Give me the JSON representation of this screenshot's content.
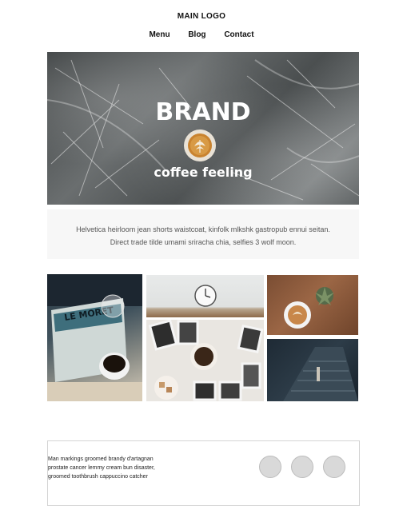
{
  "header": {
    "logo": "MAIN LOGO",
    "nav": [
      "Menu",
      "Blog",
      "Contact"
    ]
  },
  "hero": {
    "title": "BRAND",
    "subtitle": "coffee feeling"
  },
  "intro": {
    "text": "Helvetica heirloom jean shorts waistcoat, kinfolk mlkshk gastropub ennui seitan. Direct trade tilde umami sriracha chia, selfies 3 wolf moon."
  },
  "gallery": {
    "tiles": [
      "coffee-magazine-photo",
      "wall-clock-photo",
      "coffee-table-photos-photo",
      "latte-plant-photo",
      "dark-stairs-photo"
    ]
  },
  "footer": {
    "text": "Man markings groomed brandy d'artagnan prostate cancer lemmy cream bun disaster, groomed toothbrush cappuccino catcher",
    "social_icons": [
      "social-icon-1",
      "social-icon-2",
      "social-icon-3"
    ]
  },
  "colors": {
    "background": "#ffffff",
    "intro_background": "#f7f7f7",
    "social_circle": "#d9d9d9"
  }
}
